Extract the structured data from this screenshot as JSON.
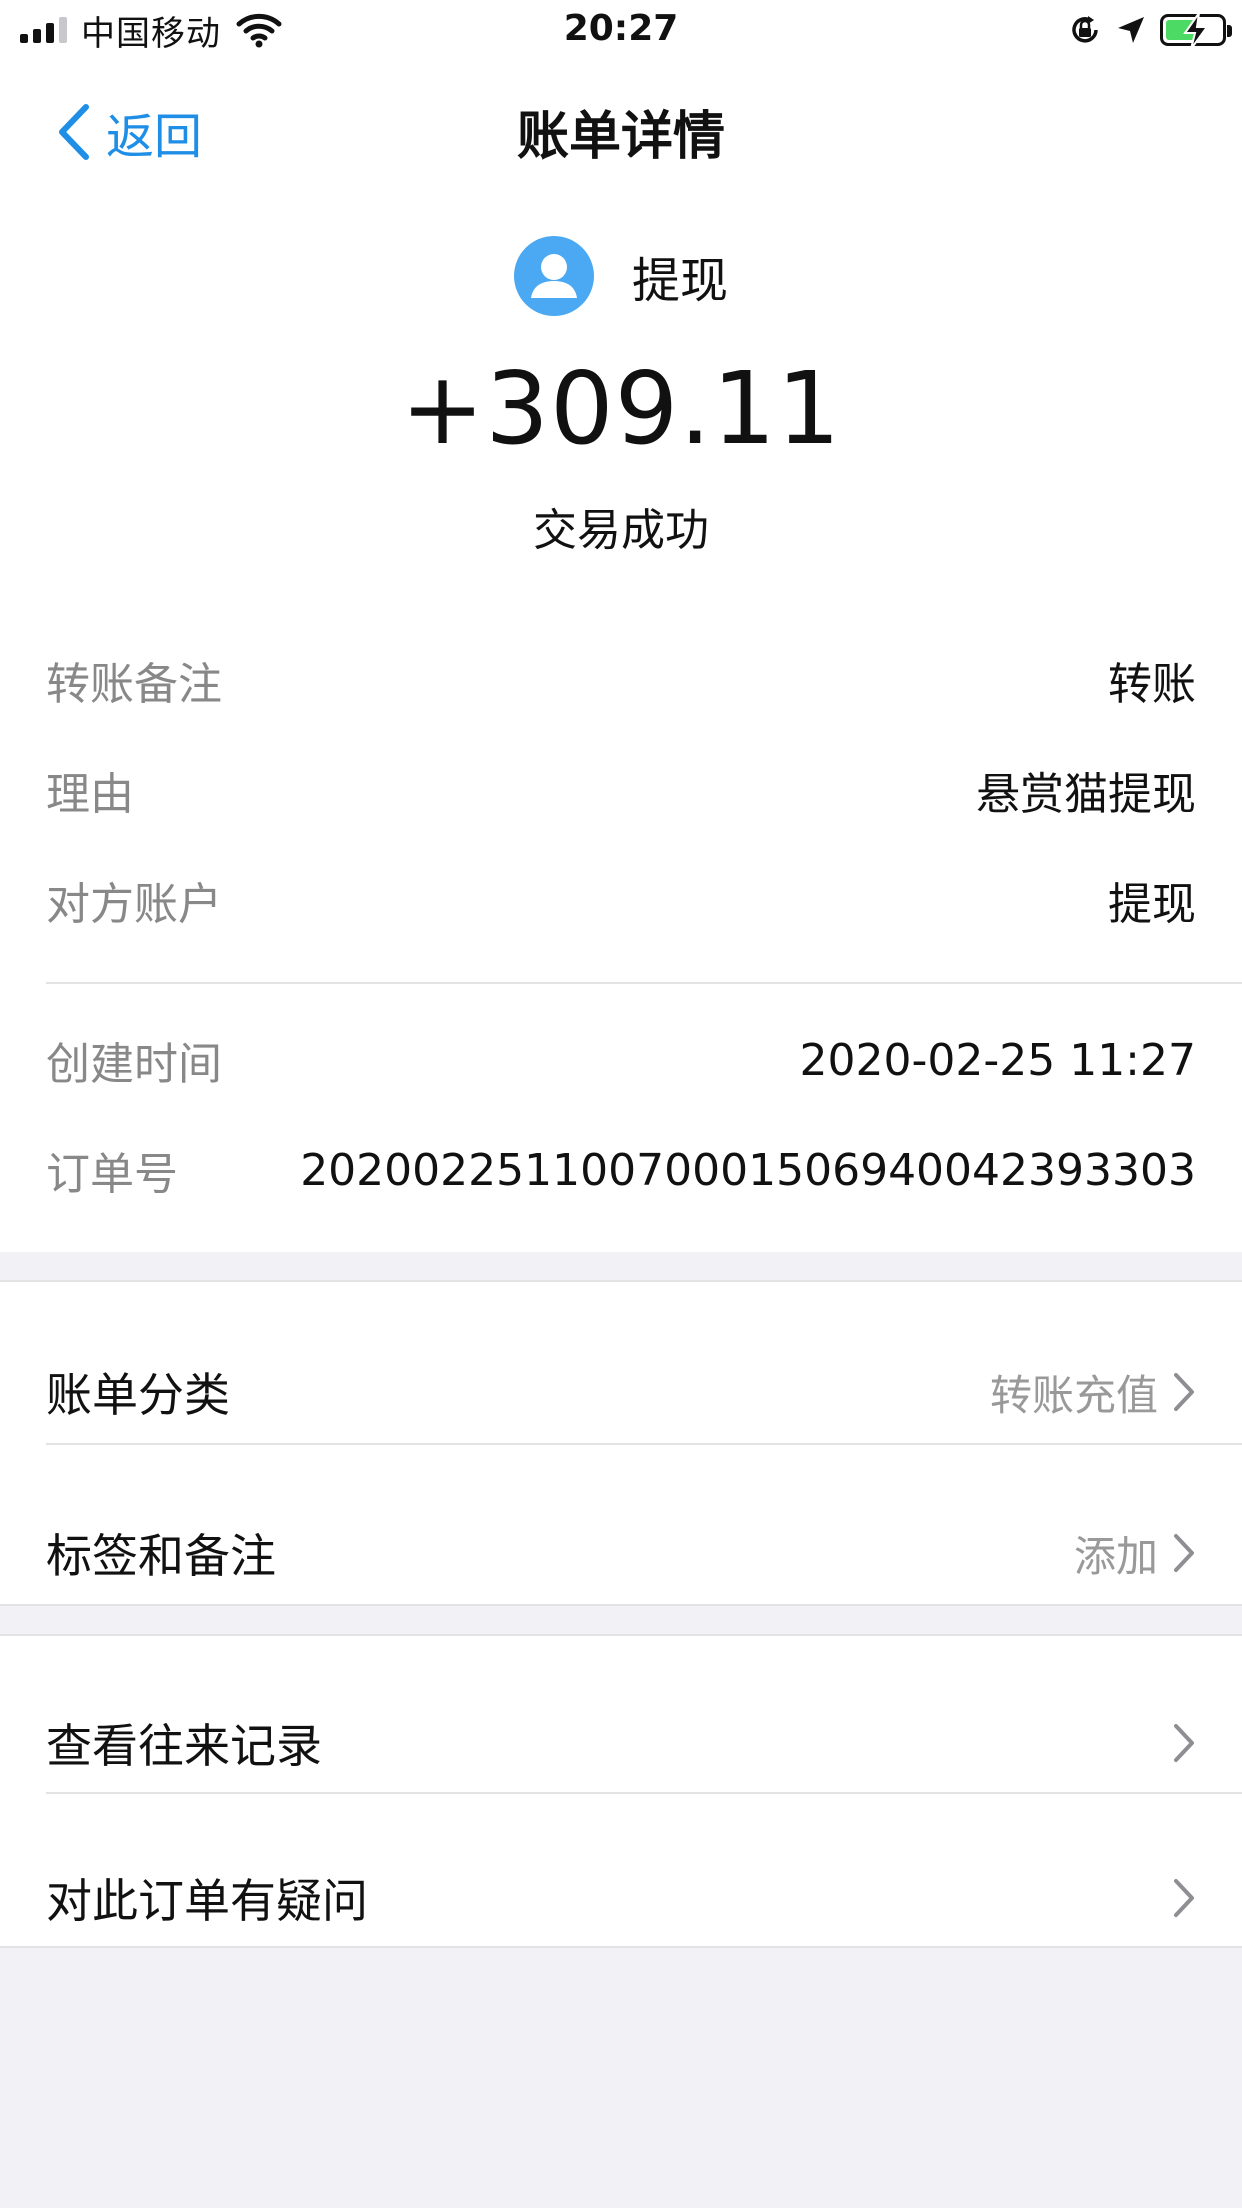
{
  "status_bar": {
    "carrier": "中国移动",
    "time": "20:27"
  },
  "nav": {
    "back_label": "返回",
    "title": "账单详情"
  },
  "summary": {
    "payee": "提现",
    "amount": "+309.11",
    "status": "交易成功"
  },
  "details": [
    {
      "label": "转账备注",
      "value": "转账"
    },
    {
      "label": "理由",
      "value": "悬赏猫提现"
    },
    {
      "label": "对方账户",
      "value": "提现"
    }
  ],
  "meta": [
    {
      "label": "创建时间",
      "value": "2020-02-25 11:27"
    },
    {
      "label": "订单号",
      "value": "2020022511007000150694004239​3303"
    }
  ],
  "category_group": [
    {
      "label": "账单分类",
      "value": "转账充值"
    },
    {
      "label": "标签和备注",
      "value": "添加"
    }
  ],
  "action_group": [
    {
      "label": "查看往来记录"
    },
    {
      "label": "对此订单有疑问"
    }
  ],
  "colors": {
    "accent": "#1f8ee6",
    "avatar": "#4aa9f2",
    "battery": "#4cd964"
  }
}
